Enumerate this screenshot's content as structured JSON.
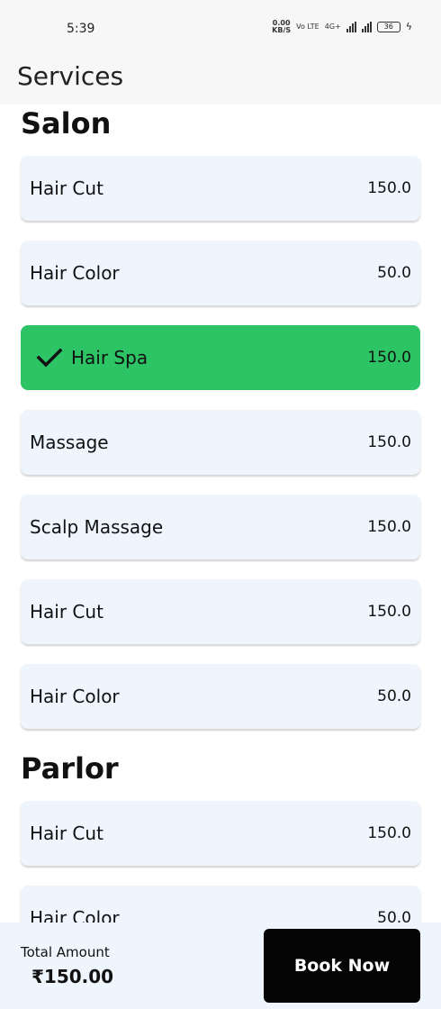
{
  "status_bar": {
    "time": "5:39",
    "net_speed_value": "0.00",
    "net_speed_unit": "KB/S",
    "volte_label": "Vo LTE",
    "network_type": "4G+",
    "battery_level": "36"
  },
  "header": {
    "title": "Services"
  },
  "sections": [
    {
      "title": "Salon",
      "items": [
        {
          "name": "Hair Cut",
          "price": "150.0",
          "selected": false
        },
        {
          "name": "Hair Color",
          "price": "50.0",
          "selected": false
        },
        {
          "name": "Hair Spa",
          "price": "150.0",
          "selected": true
        },
        {
          "name": "Massage",
          "price": "150.0",
          "selected": false
        },
        {
          "name": "Scalp Massage",
          "price": "150.0",
          "selected": false
        },
        {
          "name": "Hair Cut",
          "price": "150.0",
          "selected": false
        },
        {
          "name": "Hair Color",
          "price": "50.0",
          "selected": false
        }
      ]
    },
    {
      "title": "Parlor",
      "items": [
        {
          "name": "Hair Cut",
          "price": "150.0",
          "selected": false
        },
        {
          "name": "Hair Color",
          "price": "50.0",
          "selected": false
        }
      ]
    }
  ],
  "footer": {
    "total_label": "Total Amount",
    "total_value": "₹150.00",
    "book_label": "Book Now"
  },
  "colors": {
    "card_background": "#eef5fd",
    "selected_background": "#2cc465",
    "book_button": "#050505"
  },
  "icons": {
    "selected_marker": "check-icon"
  }
}
